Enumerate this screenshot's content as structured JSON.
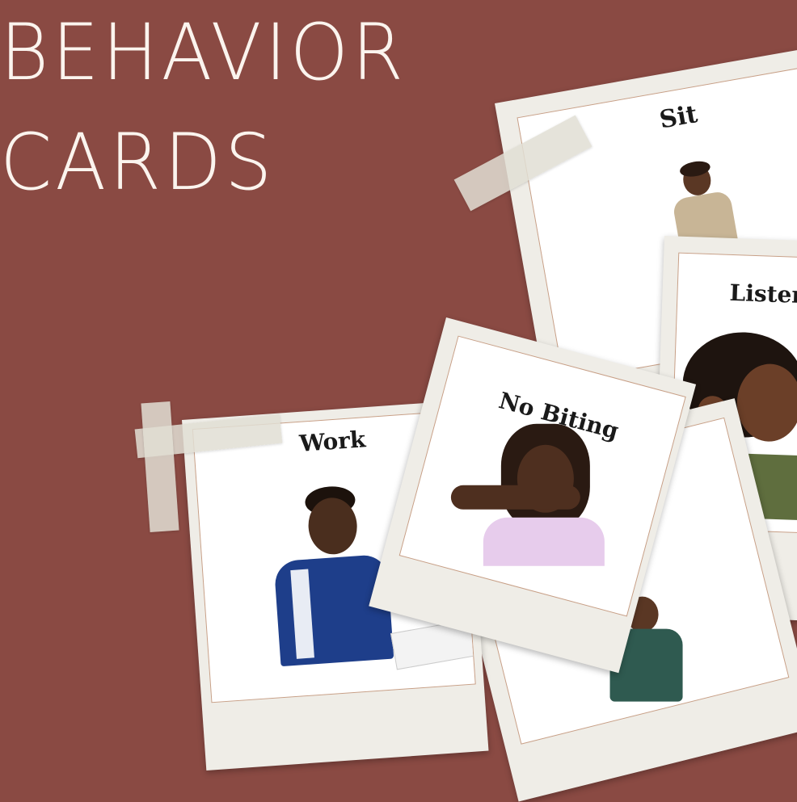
{
  "title": {
    "line1": "BEHAVIOR",
    "line2": "CARDS"
  },
  "cards": {
    "sit": {
      "label": "Sit"
    },
    "listen": {
      "label": "Listen"
    },
    "work": {
      "label": "Work"
    },
    "biting": {
      "label": "No Biting"
    },
    "bottom": {
      "label": ""
    }
  },
  "colors": {
    "background": "#8a4a43",
    "card": "#efede7",
    "title": "#fbf4ee"
  }
}
